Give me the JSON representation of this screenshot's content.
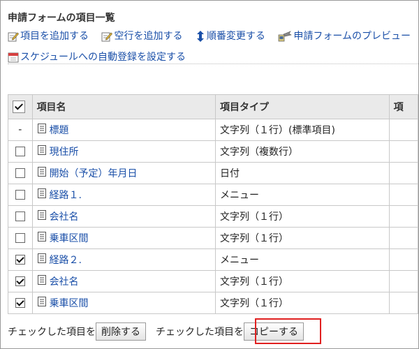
{
  "heading": "申請フォームの項目一覧",
  "actions": [
    {
      "label": "項目を追加する",
      "icon": "edit-icon"
    },
    {
      "label": "空行を追加する",
      "icon": "edit-icon"
    },
    {
      "label": "順番変更する",
      "icon": "updown-arrow-icon"
    },
    {
      "label": "申請フォームのプレビュー",
      "icon": "preview-icon"
    },
    {
      "label": "スケジュールへの自動登録を設定する",
      "icon": "calendar-icon"
    }
  ],
  "table": {
    "headers": {
      "name": "項目名",
      "type": "項目タイプ",
      "extra": "項"
    },
    "rows": [
      {
        "checkbox": "dash",
        "dash": "-",
        "name": "標題",
        "type": "文字列（１行）(標準項目)"
      },
      {
        "checkbox": "unchecked",
        "name": "現住所",
        "type": "文字列（複数行）"
      },
      {
        "checkbox": "unchecked",
        "name": "開始（予定）年月日",
        "type": "日付"
      },
      {
        "checkbox": "unchecked",
        "name": "経路１.",
        "type": "メニュー"
      },
      {
        "checkbox": "unchecked",
        "name": "会社名",
        "type": "文字列（１行）"
      },
      {
        "checkbox": "unchecked",
        "name": "乗車区間",
        "type": "文字列（１行）"
      },
      {
        "checkbox": "checked",
        "name": "経路２.",
        "type": "メニュー"
      },
      {
        "checkbox": "checked",
        "name": "会社名",
        "type": "文字列（１行）"
      },
      {
        "checkbox": "checked",
        "name": "乗車区間",
        "type": "文字列（１行）"
      }
    ]
  },
  "footer": {
    "label1": "チェックした項目を",
    "delete_button": "削除する",
    "label2": "チェックした項目を",
    "copy_button": "コピーする"
  },
  "colors": {
    "link": "#1a4fa8",
    "highlight": "#e02020",
    "header_bg": "#eaeaea"
  }
}
